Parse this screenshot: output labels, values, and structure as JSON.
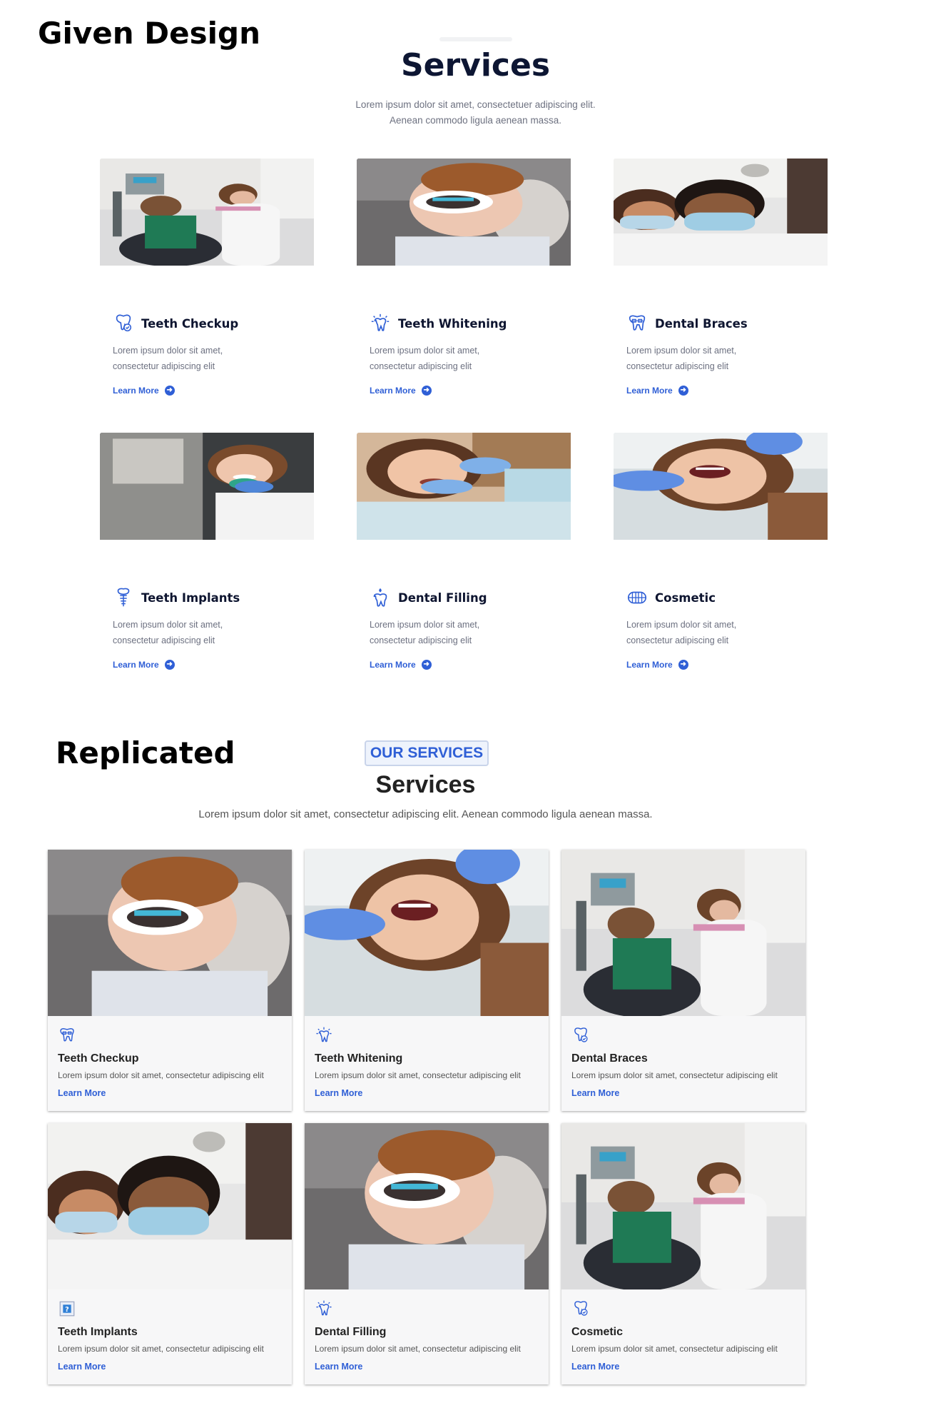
{
  "labels": {
    "given": "Given Design",
    "replicated": "Replicated"
  },
  "given": {
    "title": "Services",
    "subtitle_line1": "Lorem ipsum dolor sit amet, consectetuer adipiscing elit.",
    "subtitle_line2": "Aenean commodo ligula aenean massa.",
    "cards": [
      {
        "title": "Teeth Checkup",
        "desc": "Lorem ipsum dolor sit amet, consectetur adipiscing elit",
        "link": "Learn More",
        "icon": "tooth-check-icon",
        "photo": "dentist-checkup-photo"
      },
      {
        "title": "Teeth Whitening",
        "desc": "Lorem ipsum dolor sit amet, consectetur adipiscing elit",
        "link": "Learn More",
        "icon": "tooth-sparkle-icon",
        "photo": "patient-retractor-photo"
      },
      {
        "title": "Dental Braces",
        "desc": "Lorem ipsum dolor sit amet, consectetur adipiscing elit",
        "link": "Learn More",
        "icon": "braces-icon",
        "photo": "two-dentists-masks-photo"
      },
      {
        "title": "Teeth Implants",
        "desc": "Lorem ipsum dolor sit amet, consectetur adipiscing elit",
        "link": "Learn More",
        "icon": "implant-icon",
        "photo": "smiling-woman-photo"
      },
      {
        "title": "Dental Filling",
        "desc": "Lorem ipsum dolor sit amet, consectetur adipiscing elit",
        "link": "Learn More",
        "icon": "filling-icon",
        "photo": "woman-treatment-photo"
      },
      {
        "title": "Cosmetic",
        "desc": "Lorem ipsum dolor sit amet, consectetur adipiscing elit",
        "link": "Learn More",
        "icon": "teeth-row-icon",
        "photo": "woman-open-mouth-photo"
      }
    ]
  },
  "replicated": {
    "badge": "OUR SERVICES",
    "title": "Services",
    "subtitle": "Lorem ipsum dolor sit amet, consectetur adipiscing elit. Aenean commodo ligula aenean massa.",
    "cards": [
      {
        "title": "Teeth Checkup",
        "desc": "Lorem ipsum dolor sit amet, consectetur adipiscing elit",
        "link": "Learn More",
        "icon": "braces-icon",
        "photo": "patient-retractor-photo"
      },
      {
        "title": "Teeth Whitening",
        "desc": "Lorem ipsum dolor sit amet, consectetur adipiscing elit",
        "link": "Learn More",
        "icon": "tooth-sparkle-icon",
        "photo": "woman-open-mouth-photo"
      },
      {
        "title": "Dental Braces",
        "desc": "Lorem ipsum dolor sit amet, consectetur adipiscing elit",
        "link": "Learn More",
        "icon": "tooth-check-icon",
        "photo": "dentist-checkup-photo"
      },
      {
        "title": "Teeth Implants",
        "desc": "Lorem ipsum dolor sit amet, consectetur adipiscing elit",
        "link": "Learn More",
        "icon": "broken-image-icon",
        "photo": "two-dentists-masks-photo"
      },
      {
        "title": "Dental Filling",
        "desc": "Lorem ipsum dolor sit amet, consectetur adipiscing elit",
        "link": "Learn More",
        "icon": "tooth-sparkle-icon",
        "photo": "patient-retractor-photo"
      },
      {
        "title": "Cosmetic",
        "desc": "Lorem ipsum dolor sit amet, consectetur adipiscing elit",
        "link": "Learn More",
        "icon": "tooth-check-icon",
        "photo": "dentist-checkup-photo"
      }
    ]
  },
  "colors": {
    "accent": "#2f5fd6",
    "heading": "#0d1633",
    "text": "#6c7080"
  }
}
